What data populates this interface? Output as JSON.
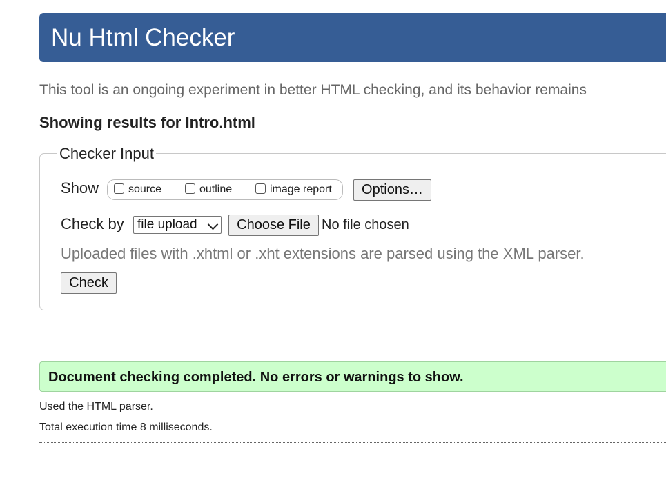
{
  "header": {
    "title": "Nu Html Checker"
  },
  "intro_text": "This tool is an ongoing experiment in better HTML checking, and its behavior remains",
  "results_heading": "Showing results for Intro.html",
  "checker_input": {
    "legend": "Checker Input",
    "show_label": "Show",
    "show_options": [
      {
        "label": "source",
        "checked": false
      },
      {
        "label": "outline",
        "checked": false
      },
      {
        "label": "image report",
        "checked": false
      }
    ],
    "options_button": "Options…",
    "check_by_label": "Check by",
    "check_by_selected": "file upload",
    "choose_file_button": "Choose File",
    "file_status": "No file chosen",
    "hint": "Uploaded files with .xhtml or .xht extensions are parsed using the XML parser.",
    "check_button": "Check"
  },
  "result": {
    "message": "Document checking completed. No errors or warnings to show.",
    "parser_info": "Used the HTML parser.",
    "execution_time": "Total execution time 8 milliseconds."
  },
  "colors": {
    "banner": "#365d95",
    "success_bg": "#ccffcc"
  }
}
